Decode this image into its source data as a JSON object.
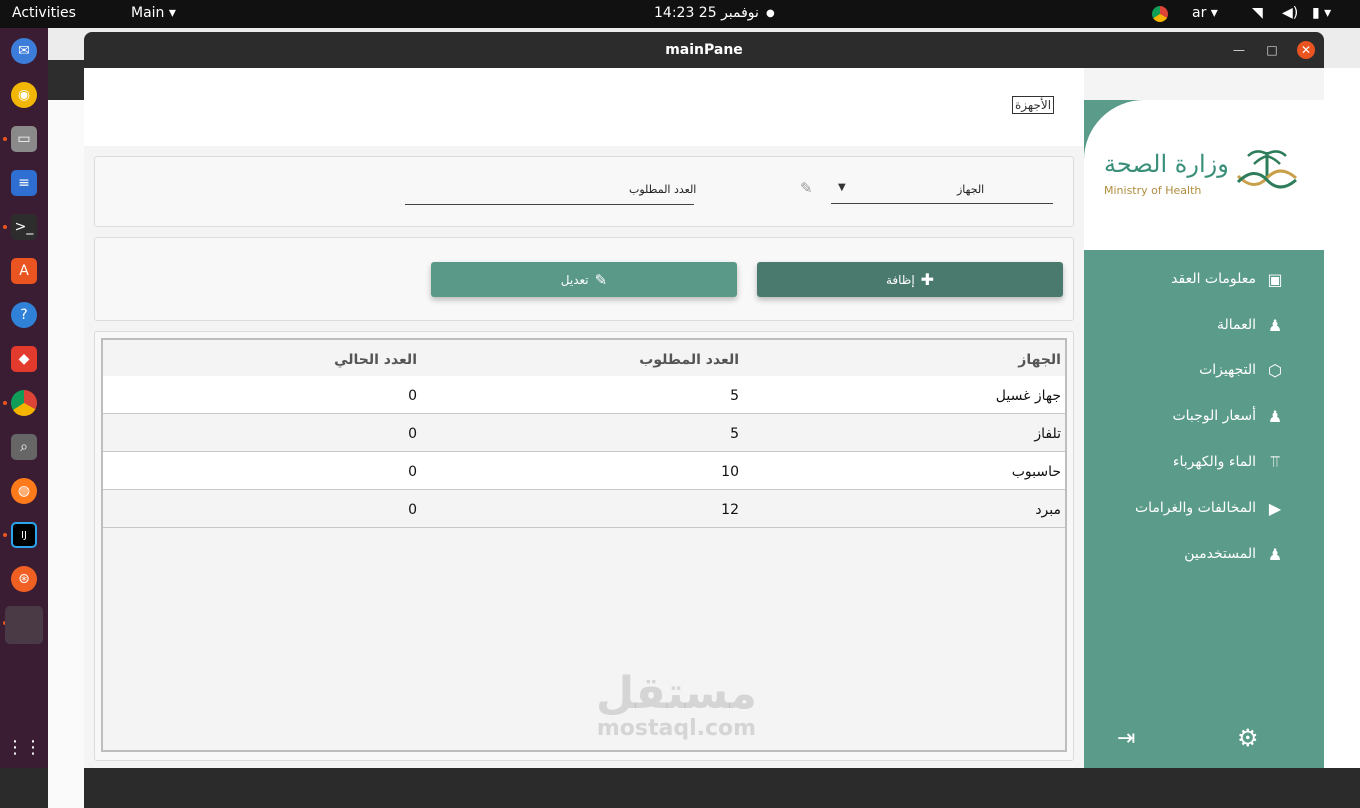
{
  "topbar": {
    "activities": "Activities",
    "app_menu": "Main",
    "clock": "14:23 نوفمبر 25",
    "language": "ar"
  },
  "window": {
    "title": "mainPane"
  },
  "page": {
    "section_label": "الأجهزة"
  },
  "form": {
    "device_label": "الجهاز",
    "required_count_label": "العدد المطلوب"
  },
  "actions": {
    "add_label": "إظافة",
    "edit_label": "تعديل"
  },
  "table": {
    "headers": [
      "الجهاز",
      "العدد المطلوب",
      "العدد الحالي"
    ],
    "rows": [
      {
        "device": "جهاز غسيل",
        "required": "5",
        "current": "0"
      },
      {
        "device": "تلفاز",
        "required": "5",
        "current": "0"
      },
      {
        "device": "حاسبوب",
        "required": "10",
        "current": "0"
      },
      {
        "device": "مبرد",
        "required": "12",
        "current": "0"
      }
    ]
  },
  "logo": {
    "arabic": "وزارة الصحة",
    "english": "Ministry of Health"
  },
  "sidebar": {
    "items": [
      {
        "label": "معلومات العقد",
        "icon": "clipboard-icon"
      },
      {
        "label": "العمالة",
        "icon": "user-icon"
      },
      {
        "label": "التجهيزات",
        "icon": "box-icon"
      },
      {
        "label": "أسعار الوجبات",
        "icon": "user-icon"
      },
      {
        "label": "الماء والكهرباء",
        "icon": "tower-icon"
      },
      {
        "label": "المخالفات والغرامات",
        "icon": "play-icon"
      },
      {
        "label": "المستخدمين",
        "icon": "user-icon"
      }
    ]
  },
  "watermark": {
    "arabic": "مستقل",
    "latin": "mostaql.com"
  },
  "colors": {
    "sidebar_bg": "#5b9b89",
    "add_button": "#4a7a6d",
    "edit_button": "#5a9887",
    "accent_orange": "#e95420"
  }
}
